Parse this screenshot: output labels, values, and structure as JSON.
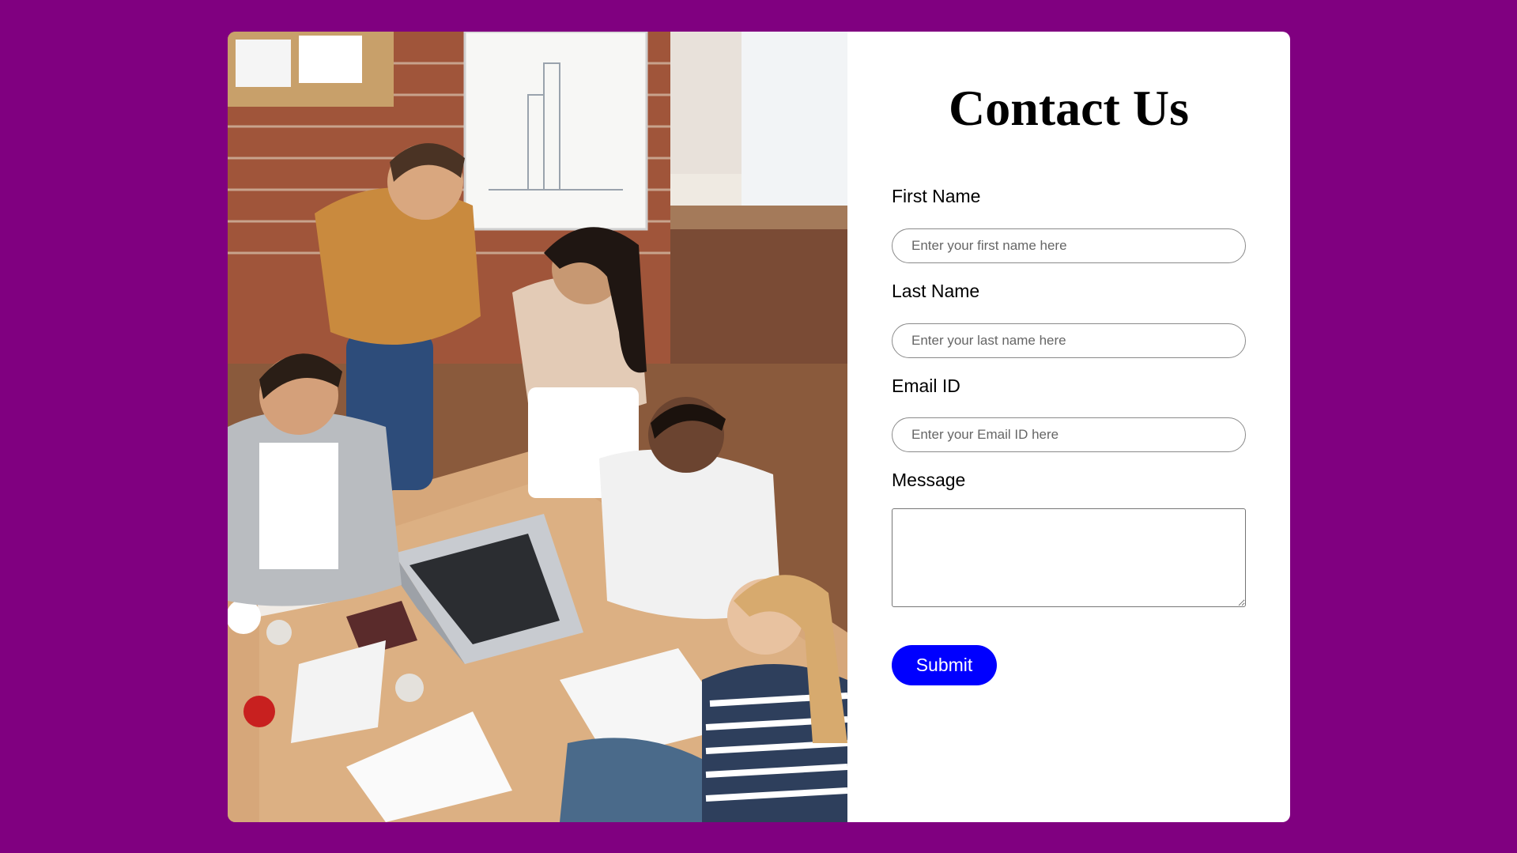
{
  "page": {
    "background_color": "#800080",
    "card_color": "#ffffff"
  },
  "image": {
    "alt": "group-meeting-photo"
  },
  "form": {
    "title": "Contact Us",
    "fields": [
      {
        "label": "First Name",
        "placeholder": "Enter your first name here",
        "value": ""
      },
      {
        "label": "Last Name",
        "placeholder": "Enter your last name here",
        "value": ""
      },
      {
        "label": "Email ID",
        "placeholder": "Enter your Email ID here",
        "value": ""
      }
    ],
    "message_label": "Message",
    "message_value": "",
    "submit_label": "Submit",
    "submit_color": "#0000ff"
  }
}
